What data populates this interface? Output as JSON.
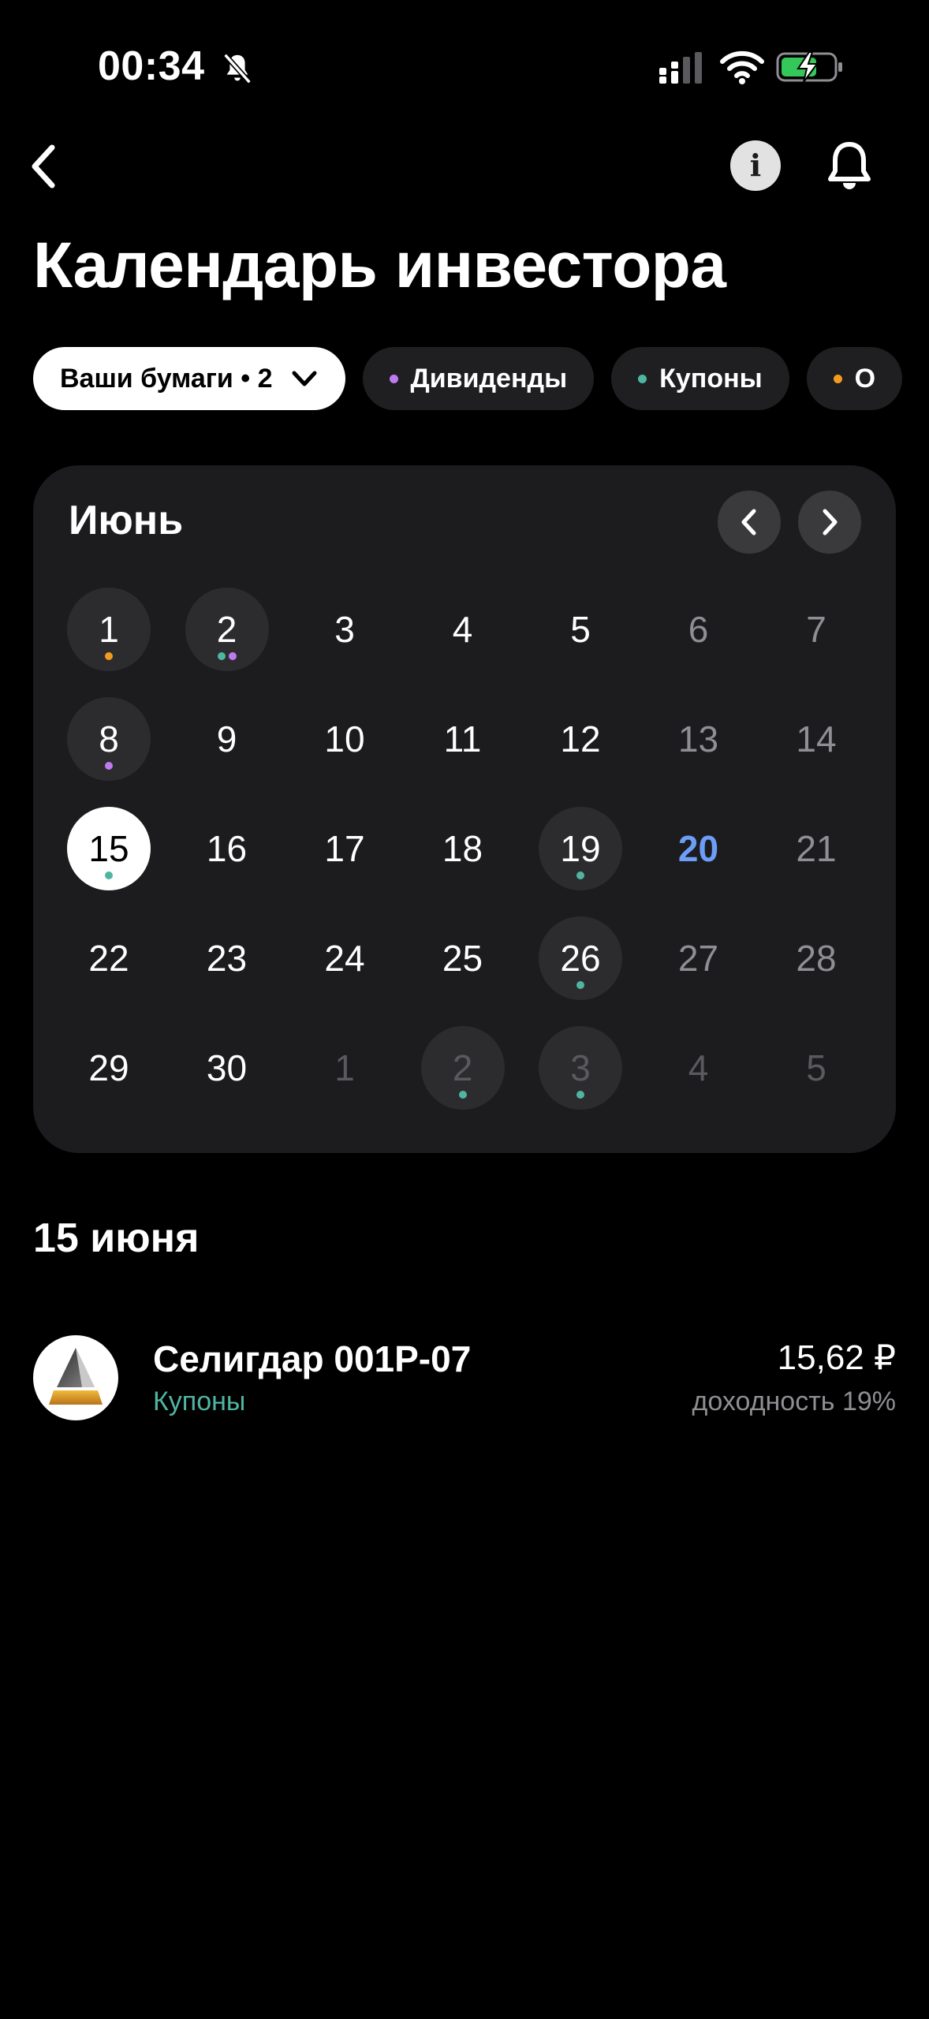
{
  "status_bar": {
    "time": "00:34"
  },
  "header": {
    "title": "Календарь инвестора"
  },
  "filters": [
    {
      "label": "Ваши бумаги • 2",
      "active": true
    },
    {
      "label": "Дивиденды",
      "dot_color": "#bf7af0"
    },
    {
      "label": "Купоны",
      "dot_color": "#4fb5a3"
    },
    {
      "label": "О",
      "dot_color": "#f39b1f"
    }
  ],
  "calendar": {
    "month": "Июнь",
    "colors": {
      "dividend": "#bf7af0",
      "coupon": "#4fb5a3",
      "other": "#f39b1f",
      "today": "#6c9ef8",
      "weekend": "#8e8e93",
      "outside": "#5a5a5e",
      "highlight_bg": "#2c2c2e"
    },
    "weeks": [
      [
        {
          "n": "1",
          "bg": true,
          "dots": [
            "other"
          ]
        },
        {
          "n": "2",
          "bg": true,
          "dots": [
            "coupon",
            "dividend"
          ]
        },
        {
          "n": "3"
        },
        {
          "n": "4"
        },
        {
          "n": "5"
        },
        {
          "n": "6",
          "weekend": true
        },
        {
          "n": "7",
          "weekend": true
        }
      ],
      [
        {
          "n": "8",
          "bg": true,
          "dots": [
            "dividend"
          ]
        },
        {
          "n": "9"
        },
        {
          "n": "10"
        },
        {
          "n": "11"
        },
        {
          "n": "12"
        },
        {
          "n": "13",
          "weekend": true
        },
        {
          "n": "14",
          "weekend": true
        }
      ],
      [
        {
          "n": "15",
          "selected": true,
          "dots": [
            "coupon"
          ]
        },
        {
          "n": "16"
        },
        {
          "n": "17"
        },
        {
          "n": "18"
        },
        {
          "n": "19",
          "bg": true,
          "dots": [
            "coupon"
          ]
        },
        {
          "n": "20",
          "today": true
        },
        {
          "n": "21",
          "weekend": true
        }
      ],
      [
        {
          "n": "22"
        },
        {
          "n": "23"
        },
        {
          "n": "24"
        },
        {
          "n": "25"
        },
        {
          "n": "26",
          "bg": true,
          "dots": [
            "coupon"
          ]
        },
        {
          "n": "27",
          "weekend": true
        },
        {
          "n": "28",
          "weekend": true
        }
      ],
      [
        {
          "n": "29"
        },
        {
          "n": "30"
        },
        {
          "n": "1",
          "outside": true
        },
        {
          "n": "2",
          "outside": true,
          "bg": true,
          "dots": [
            "coupon"
          ]
        },
        {
          "n": "3",
          "outside": true,
          "bg": true,
          "dots": [
            "coupon"
          ]
        },
        {
          "n": "4",
          "outside": true
        },
        {
          "n": "5",
          "outside": true
        }
      ]
    ]
  },
  "selected_day": {
    "heading": "15 июня",
    "events": [
      {
        "name": "Селигдар 001P-07",
        "type": "Купоны",
        "amount": "15,62 ₽",
        "yield": "доходность 19%"
      }
    ]
  }
}
